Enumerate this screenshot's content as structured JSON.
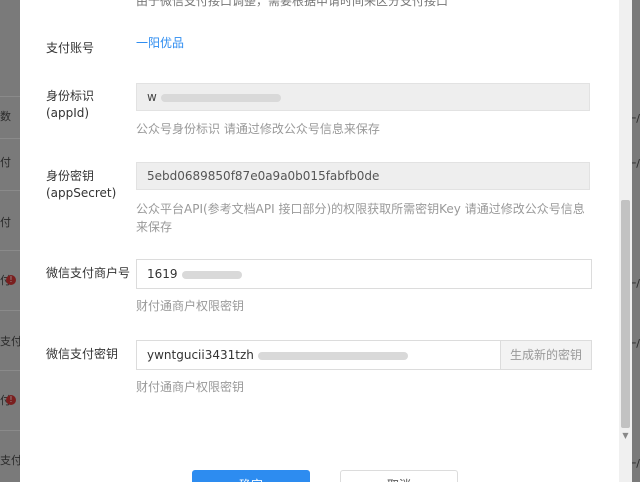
{
  "background": {
    "left_fragments": [
      "数",
      "付",
      "付",
      "付",
      "支付",
      "付",
      "支付"
    ],
    "right_fragments": [
      "一/",
      "一/",
      "一/",
      "一/",
      "一/"
    ]
  },
  "modal": {
    "top_note": "由于微信支付接口调整，需要根据申请时间来区分支付接口",
    "account": {
      "label": "支付账号",
      "value": "一阳优品"
    },
    "appid": {
      "label_line1": "身份标识",
      "label_line2": "(appId)",
      "value": "w",
      "hint": "公众号身份标识 请通过修改公众号信息来保存"
    },
    "appsecret": {
      "label_line1": "身份密钥",
      "label_line2": "(appSecret)",
      "value": "5ebd0689850f87e0a9a0b015fabfb0de",
      "hint_line1": "公众平台API(参考文档API 接口部分)的权限获取所需密钥Key 请通过修改公众号信息",
      "hint_line2": "来保存"
    },
    "merchant": {
      "label": "微信支付商户号",
      "value": "1619",
      "hint": "财付通商户权限密钥"
    },
    "paykey": {
      "label": "微信支付密钥",
      "value": "ywntgucii3431tzh",
      "addon": "生成新的密钥",
      "hint": "财付通商户权限密钥"
    },
    "buttons": {
      "confirm": "确定",
      "cancel": "取消"
    }
  },
  "colors": {
    "primary": "#2d8cf0",
    "hint": "#999999",
    "readonly_bg": "#eeeeee"
  }
}
